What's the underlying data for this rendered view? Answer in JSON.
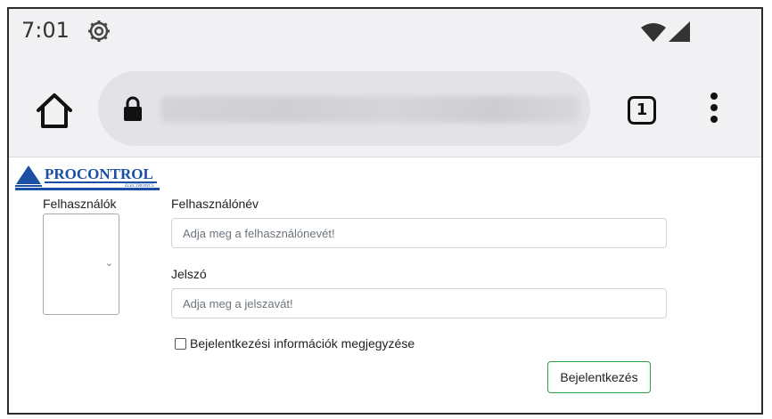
{
  "status_bar": {
    "time": "7:01"
  },
  "browser": {
    "tab_count": "1",
    "icons": [
      "gear-icon",
      "wifi-icon",
      "signal-icon",
      "home-icon",
      "lock-icon",
      "tabs-icon",
      "more-icon"
    ]
  },
  "page": {
    "logo": {
      "brand": "PROCONTROL",
      "sub": "ELECTRONICS"
    },
    "users_label": "Felhasználók",
    "username_label": "Felhasználónév",
    "username_placeholder": "Adja meg a felhasználónevét!",
    "password_label": "Jelszó",
    "password_placeholder": "Adja meg a jelszavát!",
    "remember_label": "Bejelentkezési információk megjegyzése",
    "login_button": "Bejelentkezés"
  },
  "colors": {
    "brand_blue": "#1a4fa3",
    "button_border": "#28a745",
    "chrome_bg": "#f1f1f4"
  }
}
